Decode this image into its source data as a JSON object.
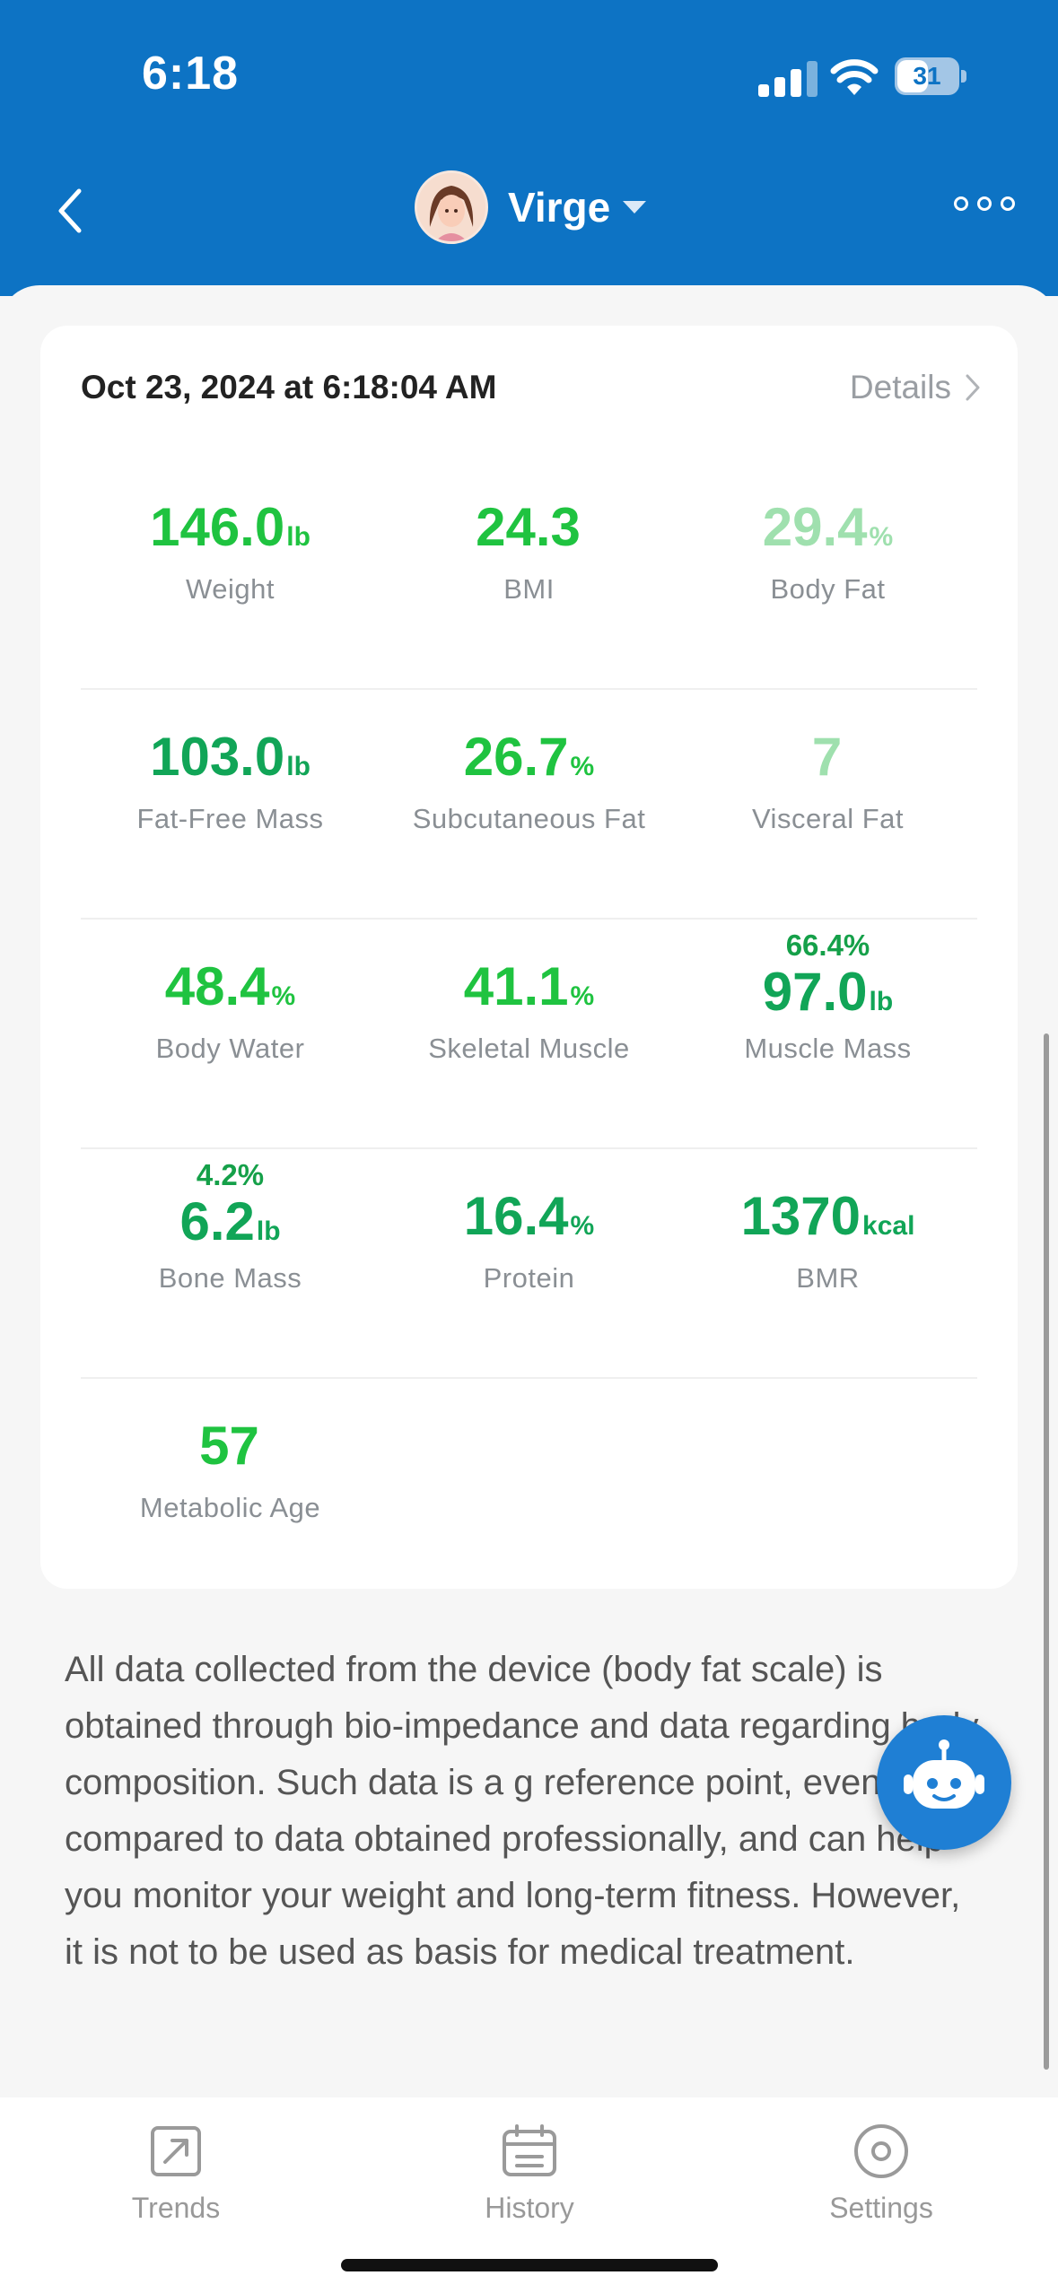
{
  "status_bar": {
    "time": "6:18",
    "battery": "31"
  },
  "header": {
    "user_name": "Virge"
  },
  "card": {
    "date": "Oct 23, 2024 at 6:18:04 AM",
    "details_label": "Details",
    "rows": [
      [
        {
          "value": "146.0",
          "unit": "lb",
          "label": "Weight",
          "sub": ""
        },
        {
          "value": "24.3",
          "unit": "",
          "label": "BMI",
          "sub": ""
        },
        {
          "value": "29.4",
          "unit": "%",
          "label": "Body Fat",
          "sub": ""
        }
      ],
      [
        {
          "value": "103.0",
          "unit": "lb",
          "label": "Fat-Free Mass",
          "sub": ""
        },
        {
          "value": "26.7",
          "unit": "%",
          "label": "Subcutaneous Fat",
          "sub": ""
        },
        {
          "value": "7",
          "unit": "",
          "label": "Visceral Fat",
          "sub": ""
        }
      ],
      [
        {
          "value": "48.4",
          "unit": "%",
          "label": "Body Water",
          "sub": ""
        },
        {
          "value": "41.1",
          "unit": "%",
          "label": "Skeletal Muscle",
          "sub": ""
        },
        {
          "value": "97.0",
          "unit": "lb",
          "label": "Muscle Mass",
          "sub": "66.4%"
        }
      ],
      [
        {
          "value": "6.2",
          "unit": "lb",
          "label": "Bone Mass",
          "sub": "4.2%"
        },
        {
          "value": "16.4",
          "unit": "%",
          "label": "Protein",
          "sub": ""
        },
        {
          "value": "1370",
          "unit": "kcal",
          "label": "BMR",
          "sub": ""
        }
      ],
      [
        {
          "value": "57",
          "unit": "",
          "label": "Metabolic Age",
          "sub": ""
        }
      ]
    ]
  },
  "disclaimer": "All data collected from the device (body fat scale) is obtained through bio-impedance and data regarding body composition. Such data is a g reference point, even when compared to data obtained professionally, and can help you monitor your weight and long-term fitness. However, it is not to be used as basis for medical treatment.",
  "tabs": [
    {
      "label": "Trends",
      "icon": "trend-arrow-icon"
    },
    {
      "label": "History",
      "icon": "calendar-icon"
    },
    {
      "label": "Settings",
      "icon": "settings-circle-icon"
    }
  ],
  "colors": {
    "header_blue": "#0d73c4",
    "metric_green": "#1fc340",
    "metric_dark_green": "#11a557",
    "metric_light_green": "#9fe0ae"
  }
}
